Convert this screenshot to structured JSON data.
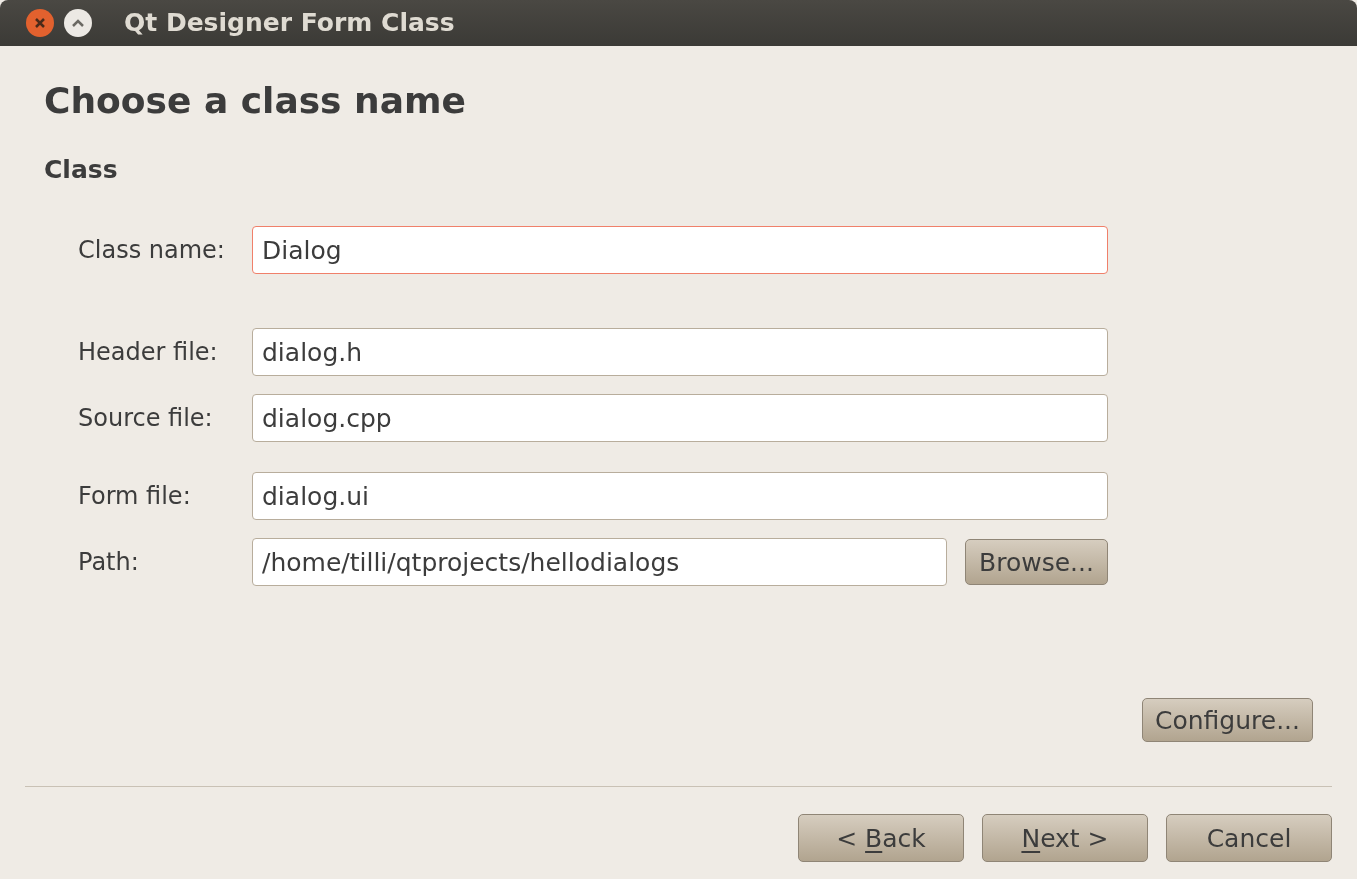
{
  "window": {
    "title": "Qt Designer Form Class"
  },
  "heading": "Choose a class name",
  "section": "Class",
  "fields": [
    {
      "label": "Class name:",
      "value": "Dialog",
      "focused": true
    },
    {
      "label": "Header file:",
      "value": "dialog.h",
      "focused": false
    },
    {
      "label": "Source file:",
      "value": "dialog.cpp",
      "focused": false
    },
    {
      "label": "Form file:",
      "value": "dialog.ui",
      "focused": false
    },
    {
      "label": "Path:",
      "value": "/home/tilli/qtprojects/hellodialogs",
      "focused": false,
      "button": "Browse..."
    }
  ],
  "configure_button": "Configure...",
  "buttons": [
    {
      "parts": [
        {
          "text": "< ",
          "underlined": false
        },
        {
          "text": "B",
          "underlined": true
        },
        {
          "text": "ack",
          "underlined": false
        }
      ]
    },
    {
      "parts": [
        {
          "text": "N",
          "underlined": true
        },
        {
          "text": "ext >",
          "underlined": false
        }
      ]
    },
    {
      "parts": [
        {
          "text": "Cancel",
          "underlined": false
        }
      ]
    }
  ]
}
